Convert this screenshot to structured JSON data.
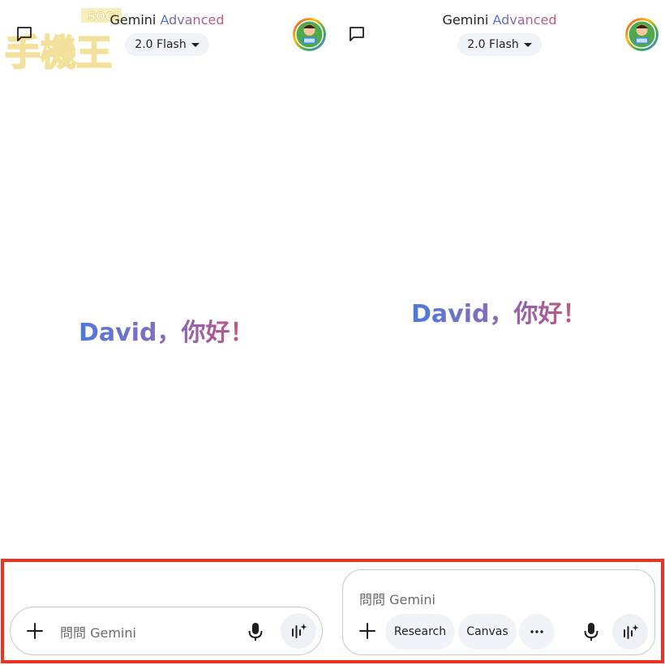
{
  "left_panel": {
    "app_title": {
      "brand": "Gemini",
      "tier": "Advanced"
    },
    "model_selector": "2.0 Flash",
    "greeting": "David，你好！",
    "input": {
      "placeholder": "問問 Gemini"
    }
  },
  "right_panel": {
    "app_title": {
      "brand": "Gemini",
      "tier": "Advanced"
    },
    "model_selector": "2.0 Flash",
    "greeting": "David，你好！",
    "input": {
      "placeholder": "問問 Gemini"
    },
    "tools": {
      "research": "Research",
      "canvas": "Canvas"
    }
  },
  "watermark": {
    "text": "SOGI 手機王"
  },
  "icons": [
    "chat-icon",
    "chevron-down-icon",
    "avatar",
    "plus-icon",
    "mic-icon",
    "live-spark-icon",
    "more-icon"
  ],
  "colors": {
    "highlight": "#ef3124",
    "pill_bg": "#f0f4f9",
    "greeting_start": "#4d7ad8",
    "greeting_end": "#d0566a"
  }
}
